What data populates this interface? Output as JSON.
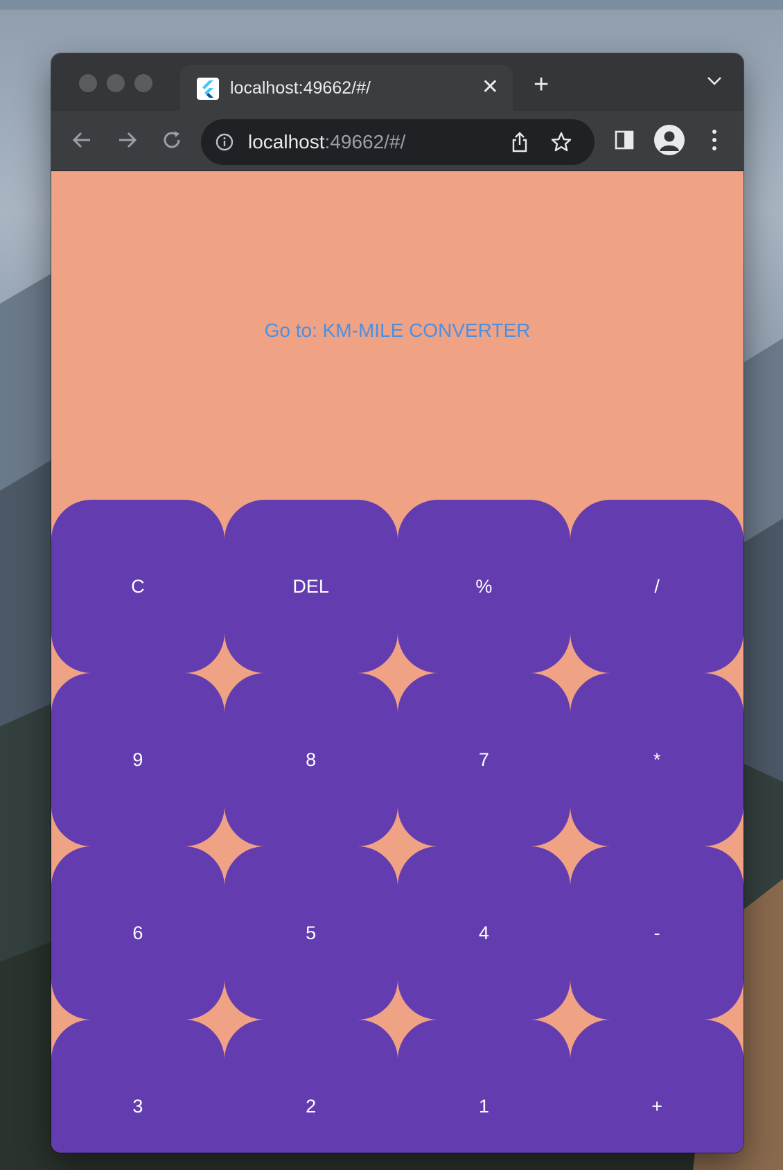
{
  "browser": {
    "tab_title": "localhost:49662/#/",
    "tab_close_glyph": "✕",
    "new_tab_glyph": "+",
    "url_host": "localhost",
    "url_rest": ":49662/#/",
    "icons": [
      "flutter-favicon-icon",
      "back-arrow-icon",
      "forward-arrow-icon",
      "reload-icon",
      "info-icon",
      "share-icon",
      "star-icon",
      "side-panel-icon",
      "profile-icon",
      "more-vert-icon",
      "tab-search-chevron-icon"
    ]
  },
  "app": {
    "link_text": "Go to: KM-MILE CONVERTER",
    "background_color": "#f0a285",
    "button_color": "#633db0",
    "link_color": "#4a90e2",
    "keys": [
      "C",
      "DEL",
      "%",
      "/",
      "9",
      "8",
      "7",
      "*",
      "6",
      "5",
      "4",
      "-",
      "3",
      "2",
      "1",
      "+"
    ]
  }
}
